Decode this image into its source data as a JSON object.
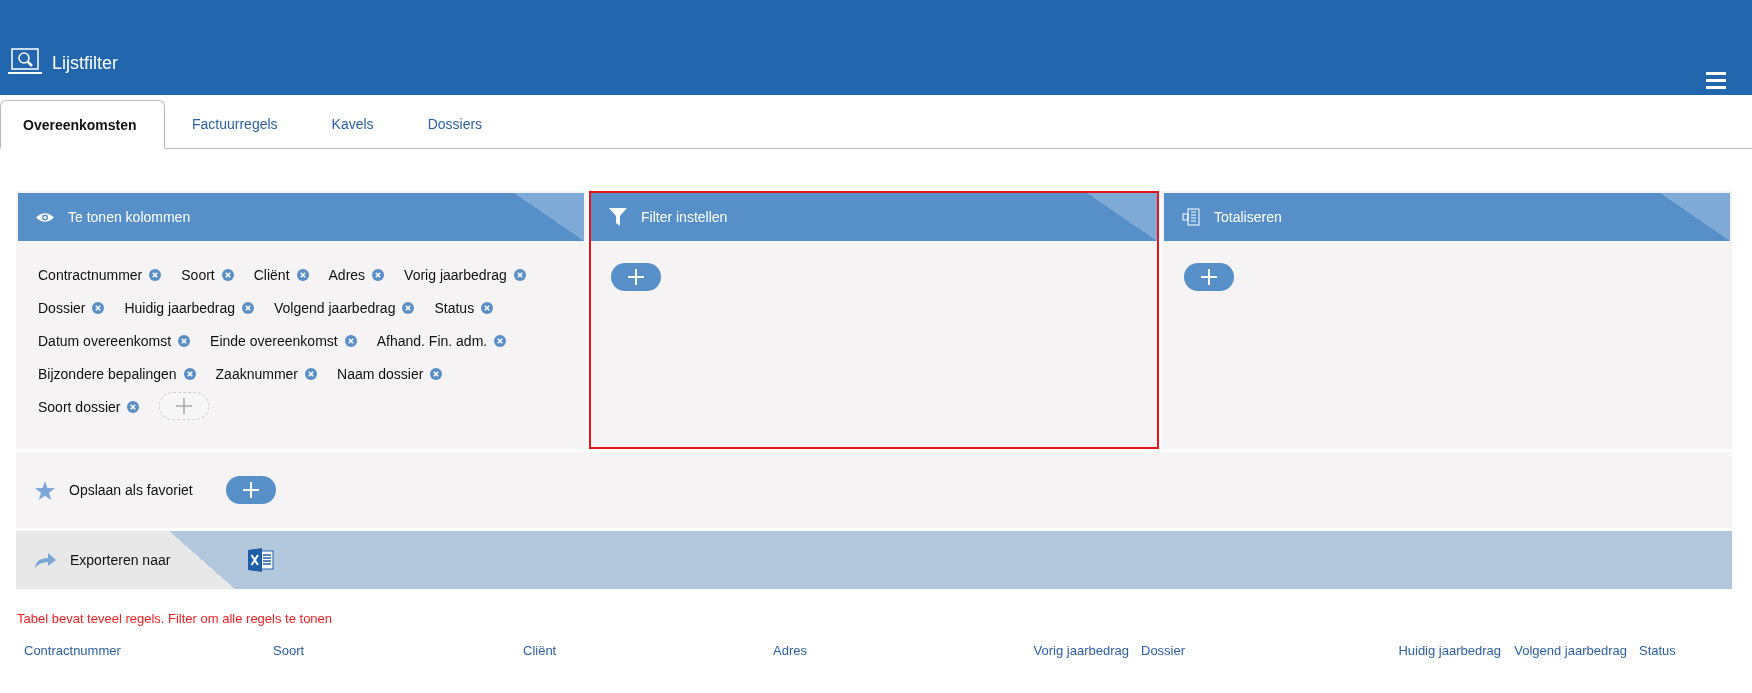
{
  "app": {
    "title": "Lijstfilter"
  },
  "tabs": [
    {
      "label": "Overeenkomsten",
      "selected": true
    },
    {
      "label": "Factuurregels",
      "selected": false
    },
    {
      "label": "Kavels",
      "selected": false
    },
    {
      "label": "Dossiers",
      "selected": false
    }
  ],
  "panels": [
    {
      "kind": "columns",
      "title": "Te tonen kolommen",
      "highlighted": false,
      "tags": [
        "Contractnummer",
        "Soort",
        "Cliënt",
        "Adres",
        "Vorig jaarbedrag",
        "Dossier",
        "Huidig jaarbedrag",
        "Volgend jaarbedrag",
        "Status",
        "Datum overeenkomst",
        "Einde overeenkomst",
        "Afhand. Fin. adm.",
        "Bijzondere bepalingen",
        "Zaaknummer",
        "Naam dossier",
        "Soort dossier"
      ]
    },
    {
      "kind": "filter",
      "title": "Filter instellen",
      "highlighted": true
    },
    {
      "kind": "totals",
      "title": "Totaliseren",
      "highlighted": false
    }
  ],
  "favorite": {
    "label": "Opslaan als favoriet"
  },
  "export": {
    "label": "Exporteren naar"
  },
  "warning": "Tabel bevat teveel regels. Filter om alle regels te tonen",
  "table": {
    "columns": [
      {
        "label": "Contractnummer",
        "kind": "text"
      },
      {
        "label": "Soort",
        "kind": "text"
      },
      {
        "label": "Cliënt",
        "kind": "text"
      },
      {
        "label": "Adres",
        "kind": "text"
      },
      {
        "label": "Vorig jaarbedrag",
        "kind": "amount"
      },
      {
        "label": "Dossier",
        "kind": "text"
      },
      {
        "label": "Huidig jaarbedrag",
        "kind": "amount"
      },
      {
        "label": "Volgend jaarbedrag",
        "kind": "amount"
      },
      {
        "label": "Status",
        "kind": "text"
      }
    ]
  }
}
